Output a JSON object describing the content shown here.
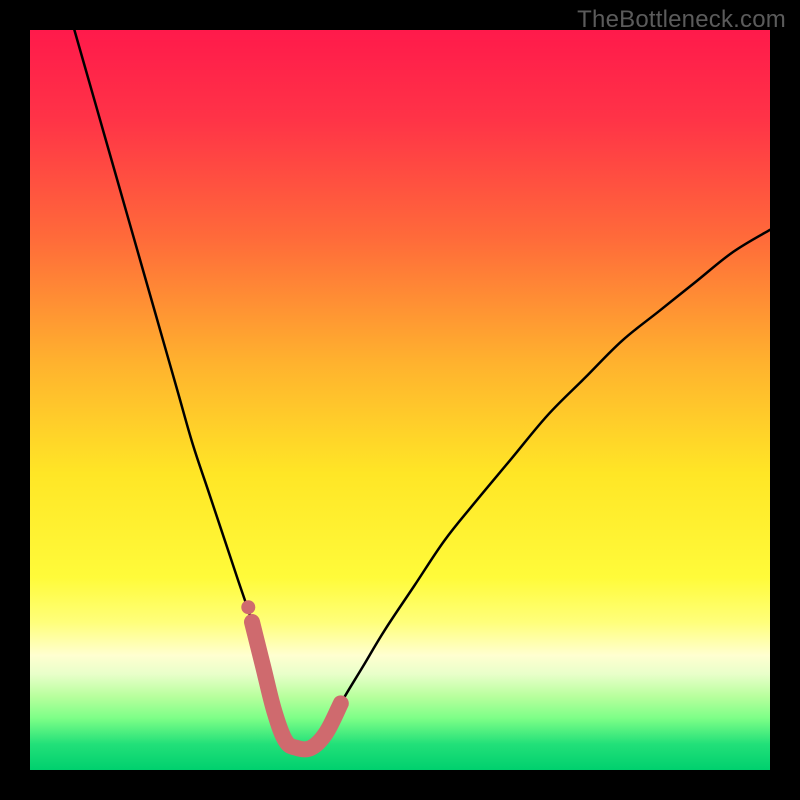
{
  "watermark": "TheBottleneck.com",
  "colors": {
    "frame": "#000000",
    "curve_black": "#000000",
    "highlight": "#cf6a6e",
    "gradient_stops": [
      {
        "offset": 0.0,
        "color": "#ff1a4b"
      },
      {
        "offset": 0.12,
        "color": "#ff3347"
      },
      {
        "offset": 0.28,
        "color": "#ff6a3a"
      },
      {
        "offset": 0.45,
        "color": "#ffb22e"
      },
      {
        "offset": 0.6,
        "color": "#ffe626"
      },
      {
        "offset": 0.74,
        "color": "#fffb3a"
      },
      {
        "offset": 0.8,
        "color": "#ffff7a"
      },
      {
        "offset": 0.845,
        "color": "#ffffd0"
      },
      {
        "offset": 0.87,
        "color": "#e9ffca"
      },
      {
        "offset": 0.9,
        "color": "#b9ff9e"
      },
      {
        "offset": 0.93,
        "color": "#7dff87"
      },
      {
        "offset": 0.965,
        "color": "#22e079"
      },
      {
        "offset": 1.0,
        "color": "#00d06e"
      }
    ]
  },
  "chart_data": {
    "type": "line",
    "title": "",
    "xlabel": "",
    "ylabel": "",
    "xlim": [
      0,
      100
    ],
    "ylim": [
      0,
      100
    ],
    "grid": false,
    "series": [
      {
        "name": "bottleneck-curve",
        "x": [
          6,
          8,
          10,
          12,
          14,
          16,
          18,
          20,
          22,
          24,
          26,
          28,
          30,
          31,
          32,
          33,
          34,
          35,
          36,
          38,
          40,
          42,
          45,
          48,
          52,
          56,
          60,
          65,
          70,
          75,
          80,
          85,
          90,
          95,
          100
        ],
        "y": [
          100,
          93,
          86,
          79,
          72,
          65,
          58,
          51,
          44,
          38,
          32,
          26,
          20,
          16,
          12,
          8,
          5,
          3,
          3,
          3,
          5,
          9,
          14,
          19,
          25,
          31,
          36,
          42,
          48,
          53,
          58,
          62,
          66,
          70,
          73
        ]
      }
    ],
    "annotations": [
      {
        "name": "highlight-valley",
        "type": "segment",
        "x": [
          30,
          31.5,
          33,
          34.5,
          36,
          38,
          40,
          42
        ],
        "y": [
          20,
          14,
          8,
          4,
          3,
          3,
          5,
          9
        ],
        "style": "thick-rounded",
        "color": "#cf6a6e"
      },
      {
        "name": "highlight-dot",
        "type": "point",
        "x": 29.5,
        "y": 22,
        "color": "#cf6a6e"
      }
    ]
  }
}
